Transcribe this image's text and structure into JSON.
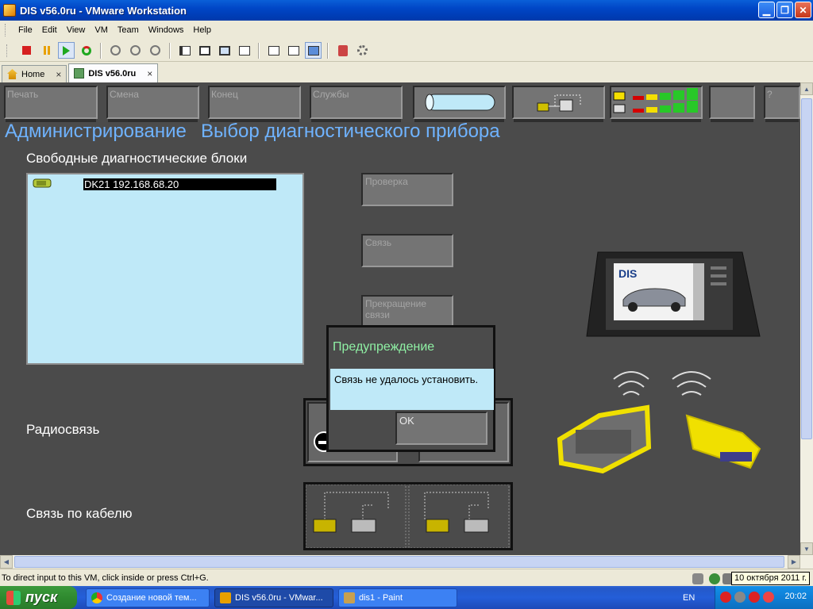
{
  "window": {
    "title": "DIS v56.0ru - VMware Workstation"
  },
  "menu": [
    "File",
    "Edit",
    "View",
    "VM",
    "Team",
    "Windows",
    "Help"
  ],
  "tabs": [
    {
      "label": "Home",
      "close": "×"
    },
    {
      "label": "DIS v56.0ru",
      "close": "×"
    }
  ],
  "dis": {
    "toolbar": {
      "print": "Печать",
      "change": "Смена",
      "end": "Конец",
      "services": "Службы",
      "help": "?"
    },
    "heading_admin": "Администрирование",
    "heading_select": "Выбор диагностического прибора",
    "free_units_label": "Свободные диагностические блоки",
    "device_entry": "DK21 192.168.68.20",
    "btn_check": "Проверка",
    "btn_connect": "Связь",
    "btn_disconnect": "Прекращение связи",
    "radio_label": "Радиосвязь",
    "cable_label": "Связь по кабелю",
    "signal_bars": [
      {
        "colors": [
          "#f5e000",
          "#d40000",
          "#f5e000",
          "#28c828",
          "#28c828",
          "#28c828"
        ]
      },
      {
        "colors": [
          "#d40000",
          "#f5e000",
          "#28c828",
          "#28c828",
          "#28c828",
          "#28c828"
        ]
      }
    ]
  },
  "dialog": {
    "title": "Предупреждение",
    "message": "Связь не удалось установить.",
    "ok": "OK"
  },
  "status": {
    "hint": "To direct input to this VM, click inside or press Ctrl+G.",
    "tooltip": "10 октября 2011 г."
  },
  "taskbar": {
    "start": "пуск",
    "tasks": [
      {
        "label": "Создание новой тем..."
      },
      {
        "label": "DIS v56.0ru - VMwar..."
      },
      {
        "label": "dis1 - Paint"
      }
    ],
    "lang": "EN",
    "clock": "20:02"
  }
}
